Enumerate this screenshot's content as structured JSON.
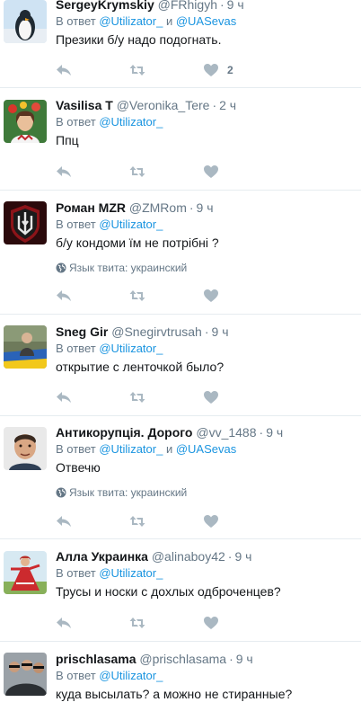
{
  "tweets": [
    {
      "name": "SergeyKrymskiy",
      "handle": "@FRhigyh",
      "time": "9 ч",
      "reply_prefix": "В ответ",
      "mention1": "@Utilizator_",
      "reply_and": "и",
      "mention2": "@UASevas",
      "text": "Презики б/у надо подогнать.",
      "like_count": "2",
      "avatar": "penguin-avatar"
    },
    {
      "name": "Vasilisa T",
      "handle": "@Veronika_Tere",
      "time": "2 ч",
      "reply_prefix": "В ответ",
      "mention1": "@Utilizator_",
      "text": "Ппц",
      "avatar": "woman-flowers-avatar"
    },
    {
      "name": "Роман MZR",
      "handle": "@ZMRom",
      "time": "9 ч",
      "reply_prefix": "В ответ",
      "mention1": "@Utilizator_",
      "text": "б/у кондоми їм не потрібні ?",
      "lang": "Язык твита: украинский",
      "avatar": "trident-emblem-avatar"
    },
    {
      "name": "Sneg Gir",
      "handle": "@Snegirvtrusah",
      "time": "9 ч",
      "reply_prefix": "В ответ",
      "mention1": "@Utilizator_",
      "text": "открытие с ленточкой было?",
      "avatar": "flag-photo-avatar"
    },
    {
      "name": "Антикорупція. Дорого",
      "handle": "@vv_1488",
      "time": "9 ч",
      "reply_prefix": "В ответ",
      "mention1": "@Utilizator_",
      "reply_and": "и",
      "mention2": "@UASevas",
      "text": "Отвечю",
      "lang": "Язык твита: украинский",
      "avatar": "man-portrait-avatar"
    },
    {
      "name": "Алла Украинка",
      "handle": "@alinaboy42",
      "time": "9 ч",
      "reply_prefix": "В ответ",
      "mention1": "@Utilizator_",
      "text": "Трусы и носки с дохлых одброченцев?",
      "avatar": "dancer-avatar"
    },
    {
      "name": "prischlasama",
      "handle": "@prischlasama",
      "time": "9 ч",
      "reply_prefix": "В ответ",
      "mention1": "@Utilizator_",
      "text": "куда высылать? а можно не стиранные?",
      "avatar": "group-photo-avatar"
    }
  ],
  "icons": {
    "reply": "reply-icon",
    "retweet": "retweet-icon",
    "like": "heart-icon",
    "lang": "globe-icon"
  },
  "colors": {
    "action_icon": "#aab8c2",
    "mention": "#1b95e0",
    "secondary_text": "#657786"
  }
}
